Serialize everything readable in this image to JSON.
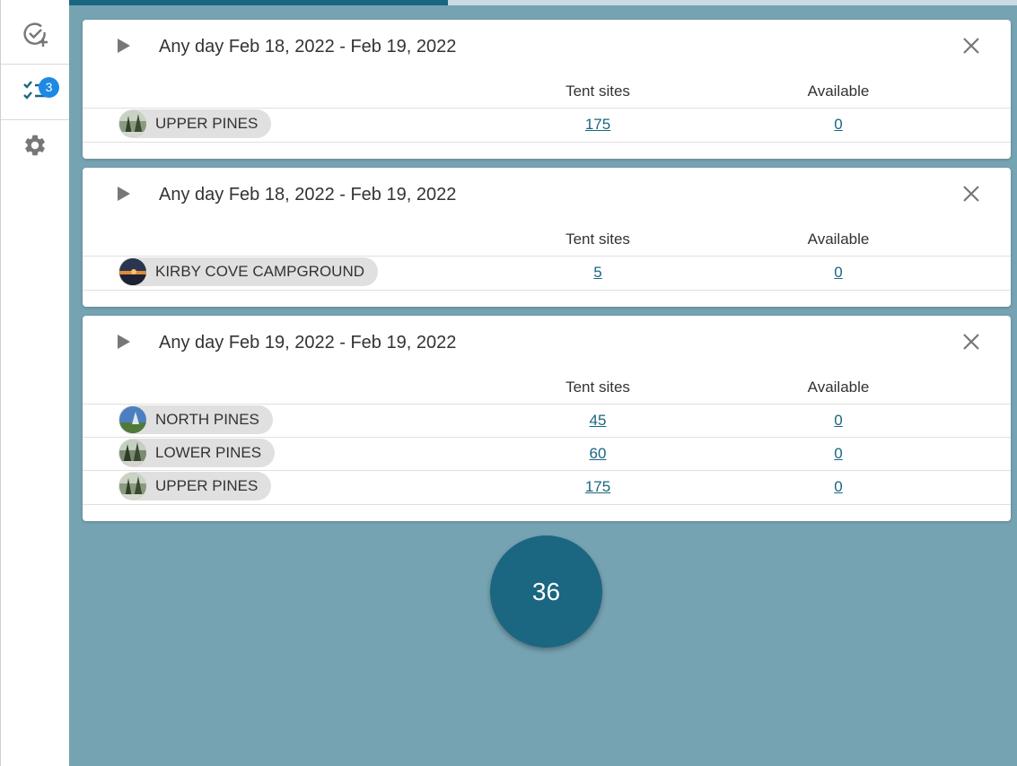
{
  "sidebar": {
    "items": [
      {
        "icon": "add-check-icon"
      },
      {
        "icon": "checklist-icon",
        "badge": "3"
      },
      {
        "icon": "gear-icon"
      }
    ]
  },
  "progress": {
    "value": 0.4,
    "color": "#1a6680"
  },
  "cards": [
    {
      "title": "Any day Feb 18, 2022 - Feb 19, 2022",
      "col_sites": "Tent sites",
      "col_available": "Available",
      "rows": [
        {
          "name": "UPPER PINES",
          "sites": "175",
          "available": "0",
          "avatar": "forest"
        }
      ]
    },
    {
      "title": "Any day Feb 18, 2022 - Feb 19, 2022",
      "col_sites": "Tent sites",
      "col_available": "Available",
      "rows": [
        {
          "name": "KIRBY COVE CAMPGROUND",
          "sites": "5",
          "available": "0",
          "avatar": "sunset"
        }
      ]
    },
    {
      "title": "Any day Feb 19, 2022 - Feb 19, 2022",
      "col_sites": "Tent sites",
      "col_available": "Available",
      "rows": [
        {
          "name": "NORTH PINES",
          "sites": "45",
          "available": "0",
          "avatar": "sky"
        },
        {
          "name": "LOWER PINES",
          "sites": "60",
          "available": "0",
          "avatar": "forest"
        },
        {
          "name": "UPPER PINES",
          "sites": "175",
          "available": "0",
          "avatar": "forest"
        }
      ]
    }
  ],
  "fab": {
    "label": "36"
  },
  "colors": {
    "background": "#76a3b2",
    "accent": "#1a6680",
    "badge": "#1e88e5"
  }
}
